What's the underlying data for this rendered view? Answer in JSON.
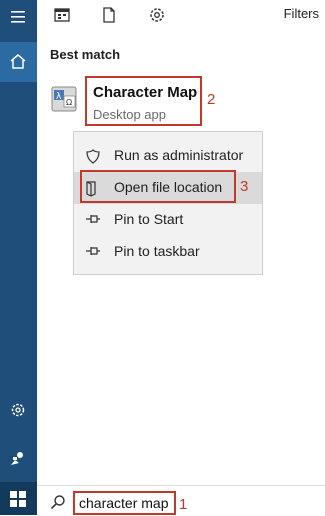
{
  "toolbar": {
    "filters_label": "Filters"
  },
  "best_match": {
    "heading": "Best match",
    "app_name": "Character Map",
    "app_type": "Desktop app"
  },
  "context_menu": {
    "items": [
      {
        "label": "Run as administrator",
        "icon": "shield-icon"
      },
      {
        "label": "Open file location",
        "icon": "folder-icon"
      },
      {
        "label": "Pin to Start",
        "icon": "pin-icon"
      },
      {
        "label": "Pin to taskbar",
        "icon": "pin-icon"
      }
    ]
  },
  "search": {
    "value": "character map",
    "icon": "search-icon"
  },
  "annotations": {
    "n1": "1",
    "n2": "2",
    "n3": "3"
  },
  "colors": {
    "rail": "#1e4e79",
    "annotation": "#c0392b",
    "menu_bg": "#f2f2f2",
    "menu_hover": "#dadada"
  }
}
